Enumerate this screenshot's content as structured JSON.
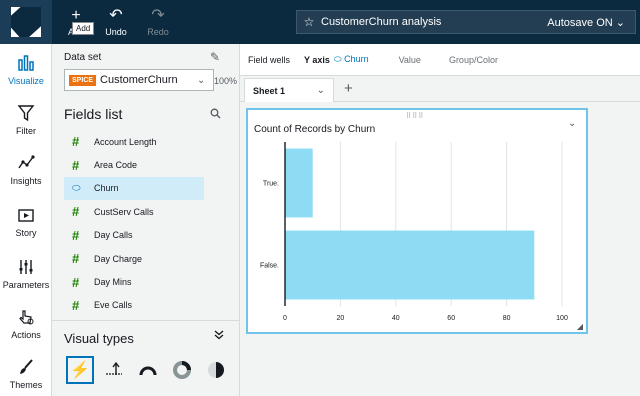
{
  "toolbar": {
    "add_label": "Add",
    "add_tooltip": "Add",
    "undo_label": "Undo",
    "redo_label": "Redo",
    "analysis_title": "CustomerChurn analysis",
    "autosave_label": "Autosave ON ⌄"
  },
  "rail": {
    "items": [
      {
        "label": "Visualize",
        "icon": "bar-chart-icon"
      },
      {
        "label": "Filter",
        "icon": "filter-icon"
      },
      {
        "label": "Insights",
        "icon": "insights-icon"
      },
      {
        "label": "Story",
        "icon": "story-icon"
      },
      {
        "label": "Parameters",
        "icon": "parameters-icon"
      },
      {
        "label": "Actions",
        "icon": "actions-icon"
      },
      {
        "label": "Themes",
        "icon": "brush-icon"
      }
    ],
    "active": "Visualize"
  },
  "dataset": {
    "heading": "Data set",
    "badge": "SPICE",
    "name": "CustomerChurn",
    "percent": "100%"
  },
  "fields": {
    "heading": "Fields list",
    "items": [
      {
        "name": "Account Length",
        "kind": "measure"
      },
      {
        "name": "Area Code",
        "kind": "measure"
      },
      {
        "name": "Churn",
        "kind": "dimension",
        "selected": true
      },
      {
        "name": "CustServ Calls",
        "kind": "measure"
      },
      {
        "name": "Day Calls",
        "kind": "measure"
      },
      {
        "name": "Day Charge",
        "kind": "measure"
      },
      {
        "name": "Day Mins",
        "kind": "measure"
      },
      {
        "name": "Eve Calls",
        "kind": "measure"
      }
    ]
  },
  "visual_types": {
    "heading": "Visual types"
  },
  "wells": {
    "label": "Field wells",
    "yaxis_label": "Y axis",
    "yaxis_field": "Churn",
    "value_label": "Value",
    "group_label": "Group/Color"
  },
  "sheet": {
    "tab_label": "Sheet 1"
  },
  "colors": {
    "accent": "#0073bb",
    "bar": "#8ddcf4",
    "topbar": "#0c2a3f",
    "measure": "#1d8102"
  },
  "chart_data": {
    "type": "bar",
    "orientation": "horizontal",
    "title": "Count of Records by Churn",
    "categories": [
      "True.",
      "False."
    ],
    "values": [
      10,
      90
    ],
    "xlim": [
      0,
      100
    ],
    "xticks": [
      0,
      20,
      40,
      60,
      80,
      100
    ],
    "grid": true
  }
}
